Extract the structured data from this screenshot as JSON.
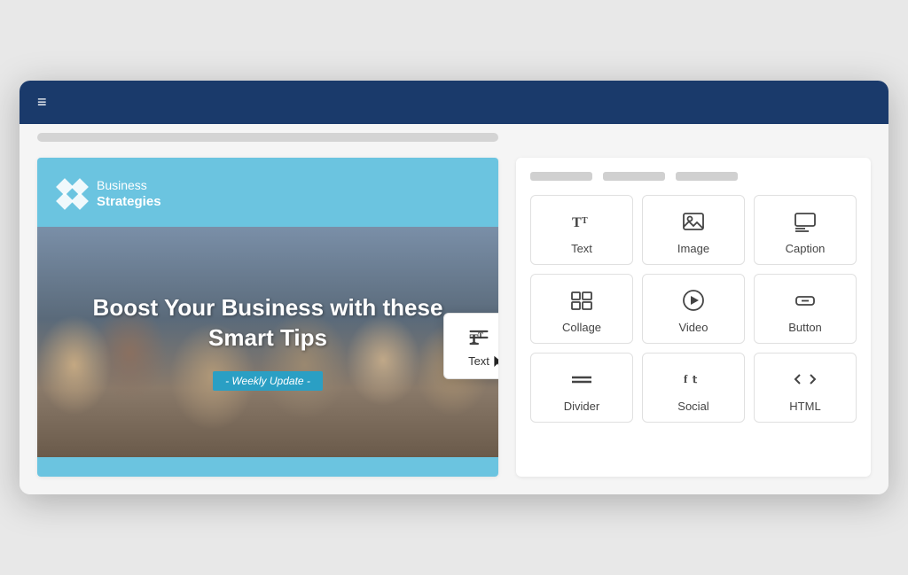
{
  "browser": {
    "hamburger": "≡",
    "address_bar_placeholder": ""
  },
  "email": {
    "logo_company": "Business",
    "logo_tagline": "Strategies",
    "hero_title": "Boost Your Business with these Smart Tips",
    "weekly_badge": "- Weekly Update -"
  },
  "tooltip": {
    "label": "Text"
  },
  "panel": {
    "tabs": [
      "",
      "",
      ""
    ],
    "widgets": [
      {
        "id": "text",
        "label": "Text",
        "icon": "text"
      },
      {
        "id": "image",
        "label": "Image",
        "icon": "image"
      },
      {
        "id": "caption",
        "label": "Caption",
        "icon": "caption"
      },
      {
        "id": "collage",
        "label": "Collage",
        "icon": "collage"
      },
      {
        "id": "video",
        "label": "Video",
        "icon": "video"
      },
      {
        "id": "button",
        "label": "Button",
        "icon": "button"
      },
      {
        "id": "divider",
        "label": "Divider",
        "icon": "divider"
      },
      {
        "id": "social",
        "label": "Social",
        "icon": "social"
      },
      {
        "id": "html",
        "label": "HTML",
        "icon": "html"
      }
    ]
  },
  "colors": {
    "header_bg": "#1a3a6b",
    "email_accent": "#6bc4e0",
    "badge_bg": "#2a9fc4"
  }
}
